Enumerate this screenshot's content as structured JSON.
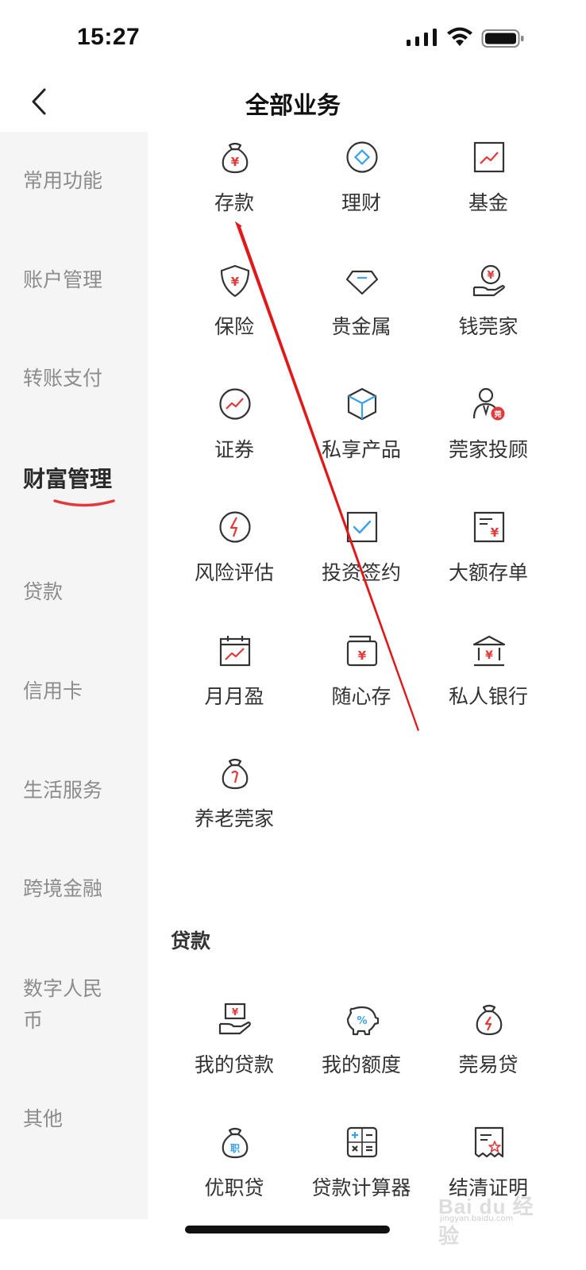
{
  "status_bar": {
    "time": "15:27"
  },
  "header": {
    "title": "全部业务"
  },
  "sidebar": {
    "items": [
      {
        "label": "常用功能"
      },
      {
        "label": "账户管理"
      },
      {
        "label": "转账支付"
      },
      {
        "label": "财富管理"
      },
      {
        "label": "贷款"
      },
      {
        "label": "信用卡"
      },
      {
        "label": "生活服务"
      },
      {
        "label": "跨境金融"
      },
      {
        "label": "数字人民币"
      },
      {
        "label": "其他"
      }
    ],
    "active_index": 3
  },
  "wealth": {
    "items": [
      {
        "label": "存款",
        "icon": "money-bag-icon"
      },
      {
        "label": "理财",
        "icon": "diamond-circle-icon"
      },
      {
        "label": "基金",
        "icon": "chart-frame-icon"
      },
      {
        "label": "保险",
        "icon": "shield-icon"
      },
      {
        "label": "贵金属",
        "icon": "gem-icon"
      },
      {
        "label": "钱莞家",
        "icon": "coin-hand-icon"
      },
      {
        "label": "证券",
        "icon": "trend-circle-icon"
      },
      {
        "label": "私享产品",
        "icon": "cube-icon"
      },
      {
        "label": "莞家投顾",
        "icon": "advisor-icon"
      },
      {
        "label": "风险评估",
        "icon": "lightning-circle-icon"
      },
      {
        "label": "投资签约",
        "icon": "check-box-icon"
      },
      {
        "label": "大额存单",
        "icon": "certificate-icon"
      },
      {
        "label": "月月盈",
        "icon": "calendar-chart-icon"
      },
      {
        "label": "随心存",
        "icon": "wallet-icon"
      },
      {
        "label": "私人银行",
        "icon": "bank-icon"
      },
      {
        "label": "养老莞家",
        "icon": "pension-bag-icon"
      }
    ]
  },
  "loan": {
    "title": "贷款",
    "items": [
      {
        "label": "我的贷款",
        "icon": "loan-hand-icon"
      },
      {
        "label": "我的额度",
        "icon": "piggy-bank-icon"
      },
      {
        "label": "莞易贷",
        "icon": "lightning-bag-icon"
      },
      {
        "label": "优职贷",
        "icon": "job-bag-icon"
      },
      {
        "label": "贷款计算器",
        "icon": "calculator-icon"
      },
      {
        "label": "结清证明",
        "icon": "receipt-icon"
      }
    ]
  },
  "watermark": {
    "main": "Bai du 经验",
    "sub": "jingyan.baidu.com"
  },
  "colors": {
    "accent": "#e03a3a",
    "icon_stroke": "#333333",
    "info": "#3aa0e8",
    "annotation_arrow": "#e01818"
  }
}
